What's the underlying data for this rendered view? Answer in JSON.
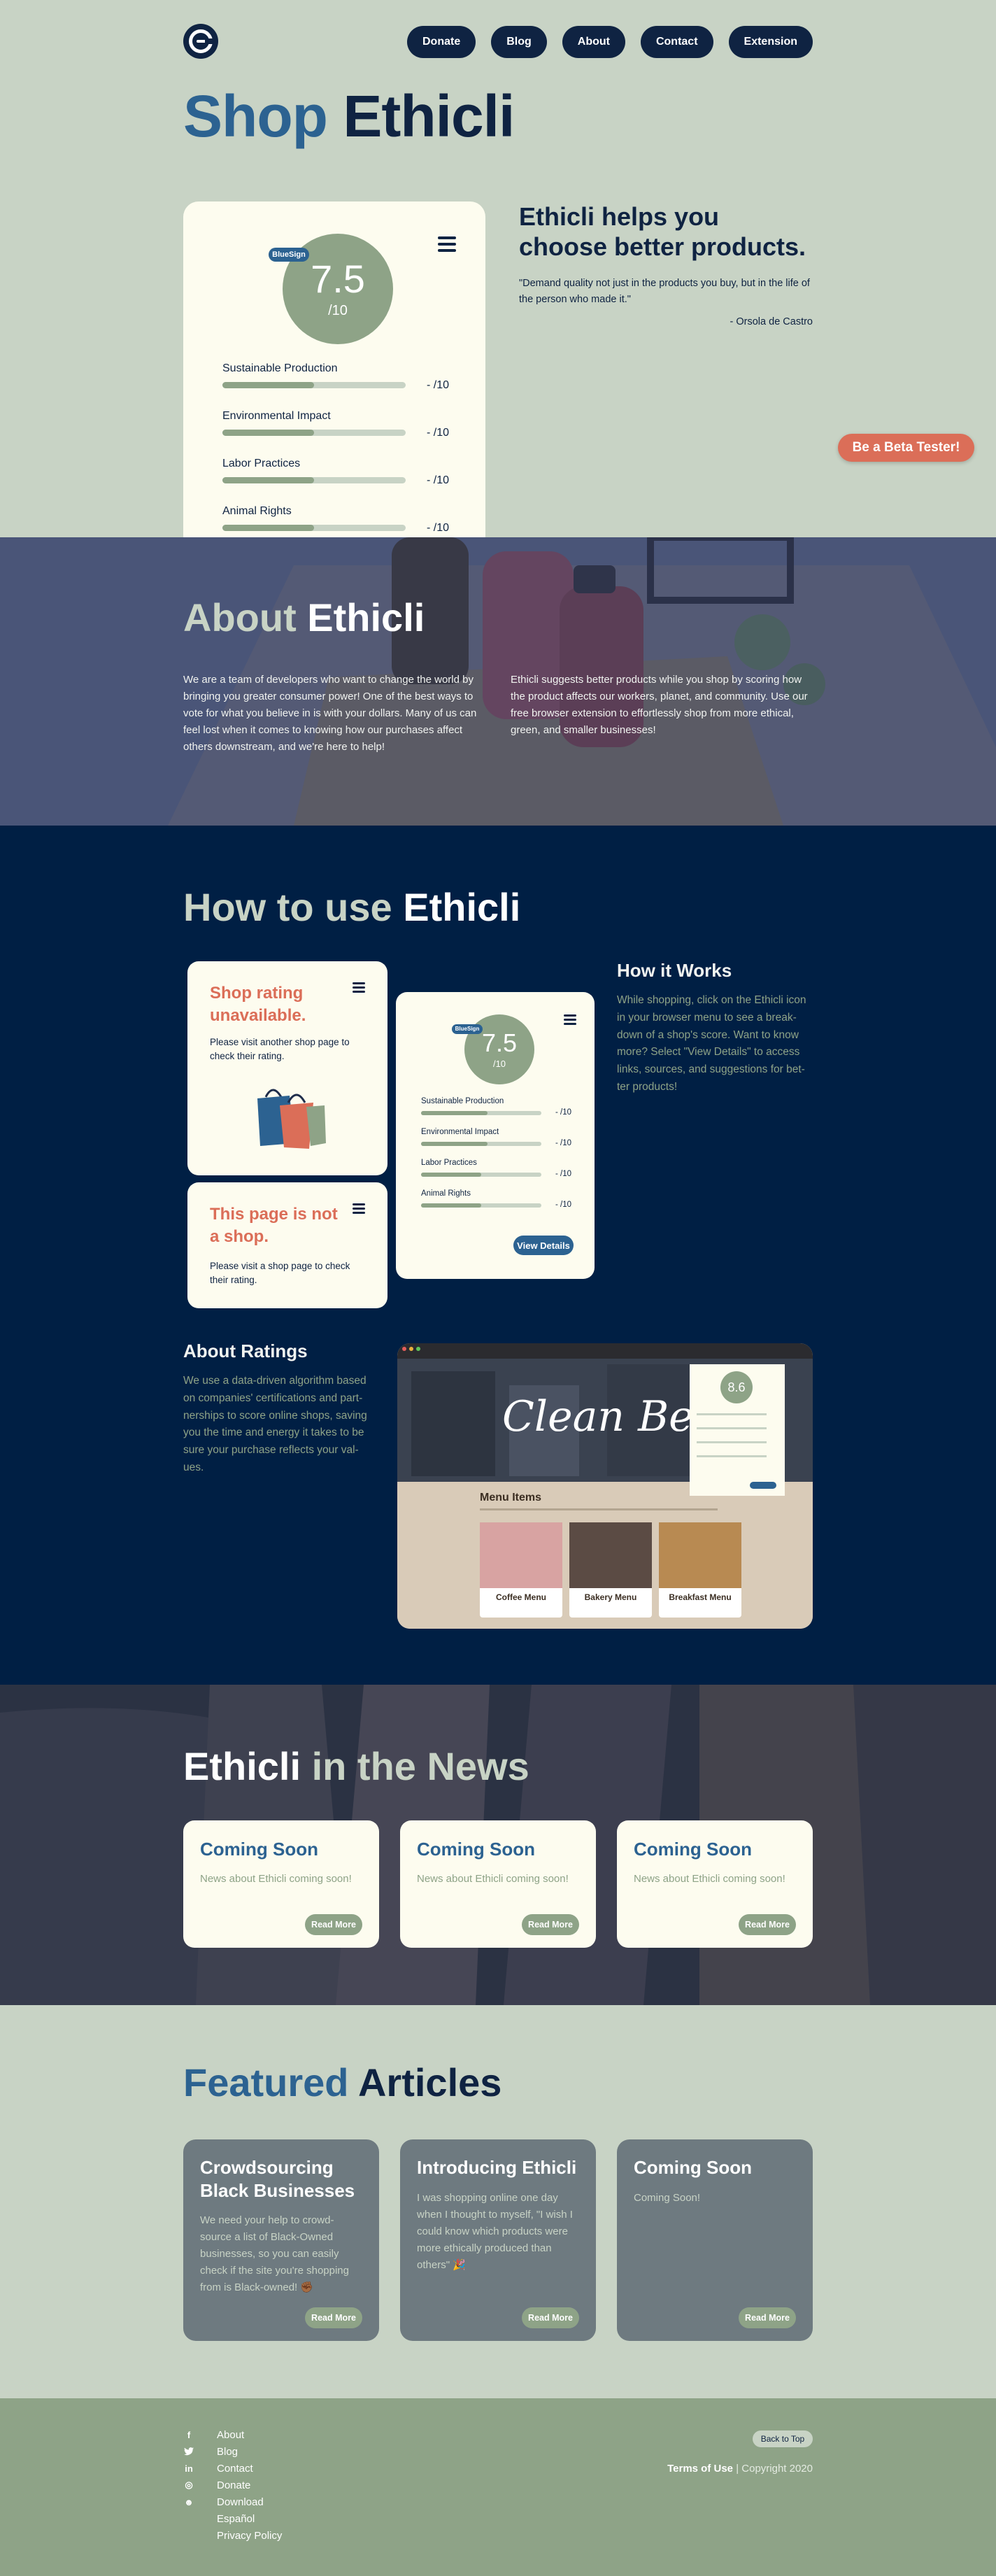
{
  "nav": {
    "logo": "ethicli-logo",
    "items": [
      {
        "label": "Donate"
      },
      {
        "label": "Blog"
      },
      {
        "label": "About"
      },
      {
        "label": "Contact"
      },
      {
        "label": "Extension"
      }
    ]
  },
  "hero": {
    "title_a": "Shop",
    "title_b": "Ethicli",
    "card": {
      "badge": "BlueSign",
      "score": "7.5",
      "score_max": "/10",
      "ratings": [
        {
          "label": "Sustainable Production",
          "value": "- /10",
          "fill": 0.5
        },
        {
          "label": "Environmental Impact",
          "value": "- /10",
          "fill": 0.5
        },
        {
          "label": "Labor Practices",
          "value": "- /10",
          "fill": 0.5
        },
        {
          "label": "Animal Rights",
          "value": "- /10",
          "fill": 0.5
        }
      ]
    },
    "heading": "Ethicli helps you choose better products.",
    "quote": "\"Demand quality not just in the products you buy, but in the life of the person who made it.\"",
    "author": "- Orsola de Castro",
    "beta_button": "Be a Beta Tester!"
  },
  "about": {
    "title_a": "About",
    "title_b": "Ethicli",
    "p1": "We are a team of developers who want to change the world by bringing you greater consumer power! One of the best ways to vote for what you believe in is with your dollars. Many of us can feel lost when it comes to knowing how our purchases affect others downstream, and we're here to help!",
    "p2": "Ethicli suggests better products while you shop by scoring how the product affects our workers, planet, and community. Use our free browser extension to effortlessly shop from more ethical, green, and smaller businesses!"
  },
  "howto": {
    "title_a": "How to use",
    "title_b": "Ethicli",
    "unavailable": {
      "title": "Shop rating unavailable.",
      "text": "Please visit another shop page to check their rating."
    },
    "not_shop": {
      "title": "This page is not a shop.",
      "text": "Please visit a shop page to check their rating."
    },
    "rating_card": {
      "badge": "BlueSign",
      "score": "7.5",
      "score_max": "/10",
      "ratings": [
        {
          "label": "Sustainable Production",
          "value": "- /10",
          "fill": 0.55
        },
        {
          "label": "Environmental Impact",
          "value": "- /10",
          "fill": 0.55
        },
        {
          "label": "Labor Practices",
          "value": "- /10",
          "fill": 0.5
        },
        {
          "label": "Animal Rights",
          "value": "- /10",
          "fill": 0.5
        }
      ],
      "button": "View Details"
    },
    "how_title": "How it Works",
    "how_text": "While shopping, click on the Ethicli icon in your browser menu to see a break-down of a shop's score. Want to know more? Select \"View Details\" to access links, sources, and suggestions for bet-ter products!",
    "ratings_title": "About Ratings",
    "ratings_text": "We use a data-driven algorithm based on companies' certifications and part-nerships to score online shops, saving you the time and energy it takes to be sure your purchase reflects your val-ues.",
    "screenshot": {
      "banner": "Clean Bean Ca",
      "menu_title": "Menu Items",
      "popup_score": "8.6",
      "items": [
        {
          "name": "Coffee Menu"
        },
        {
          "name": "Bakery Menu"
        },
        {
          "name": "Breakfast Menu"
        }
      ]
    }
  },
  "news": {
    "title_a": "Ethicli",
    "title_b": "in the News",
    "cards": [
      {
        "title": "Coming Soon",
        "text": "News about Ethicli coming soon!",
        "button": "Read More"
      },
      {
        "title": "Coming Soon",
        "text": "News about Ethicli coming soon!",
        "button": "Read More"
      },
      {
        "title": "Coming Soon",
        "text": "News about Ethicli coming soon!",
        "button": "Read More"
      }
    ]
  },
  "featured": {
    "title_a": "Featured",
    "title_b": "Articles",
    "cards": [
      {
        "title": "Crowdsourcing Black Businesses",
        "text": "We need your help to crowd-source a list of Black-Owned businesses, so you can easily check if the site you're shopping from is Black-owned! ✊🏾",
        "button": "Read More"
      },
      {
        "title": "Introducing Ethicli",
        "text": "I was shopping online one day when I thought to myself, \"I wish I could know which products were more ethically produced than others\" 🎉",
        "button": "Read More"
      },
      {
        "title": "Coming Soon",
        "text": "Coming Soon!",
        "button": "Read More"
      }
    ]
  },
  "footer": {
    "links": [
      {
        "icon": "facebook-icon",
        "glyph": "f",
        "label": "About"
      },
      {
        "icon": "twitter-icon",
        "glyph": "t",
        "label": "Blog"
      },
      {
        "icon": "linkedin-icon",
        "glyph": "in",
        "label": "Contact"
      },
      {
        "icon": "instagram-icon",
        "glyph": "◎",
        "label": "Donate"
      },
      {
        "icon": "reddit-icon",
        "glyph": "☻",
        "label": "Download"
      },
      {
        "icon": "",
        "glyph": "",
        "label": "Español"
      },
      {
        "icon": "",
        "glyph": "",
        "label": "Privacy Policy"
      }
    ],
    "back_to_top": "Back to Top",
    "terms": "Terms of Use",
    "copyright": " | Copyright 2020"
  }
}
